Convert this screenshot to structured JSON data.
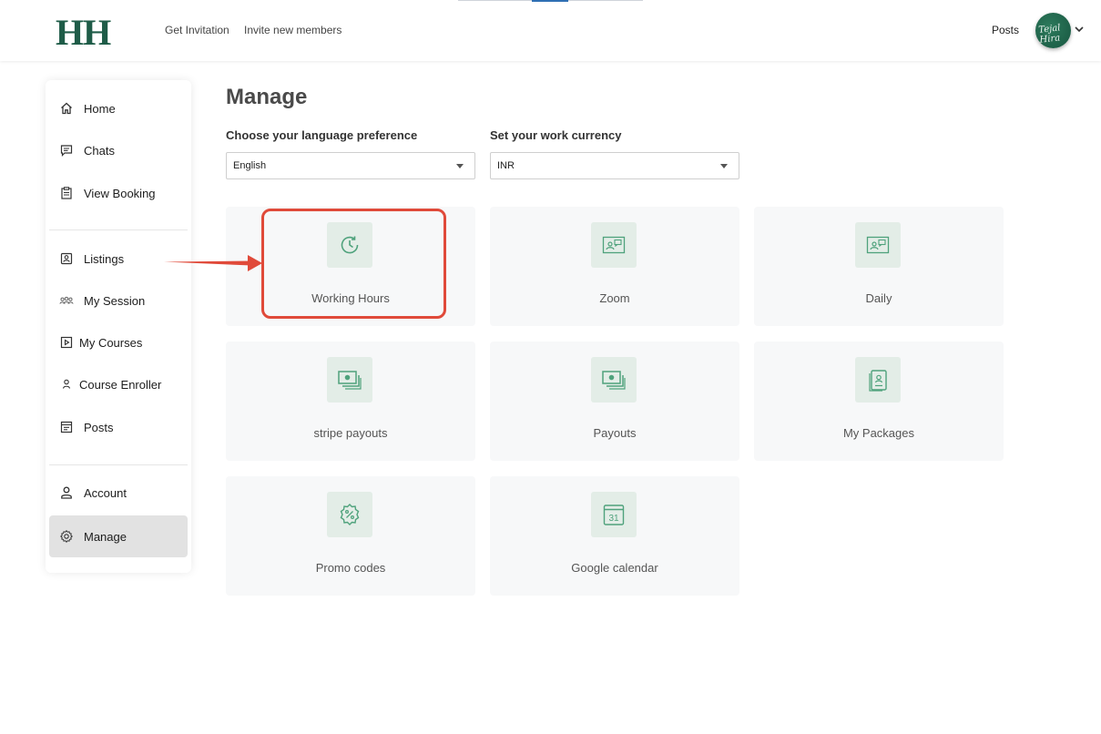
{
  "header": {
    "logo": "HH",
    "links": [
      "Get Invitation",
      "Invite new members"
    ],
    "posts_link": "Posts",
    "avatar_text": "Tejal Hira"
  },
  "sidebar": {
    "group1": [
      {
        "label": "Home",
        "icon": "home-icon"
      },
      {
        "label": "Chats",
        "icon": "chat-icon"
      },
      {
        "label": "View Booking",
        "icon": "clipboard-icon"
      }
    ],
    "group2": [
      {
        "label": "Listings",
        "icon": "listing-icon"
      },
      {
        "label": "My Session",
        "icon": "group-icon"
      },
      {
        "label": "My Courses",
        "icon": "play-icon"
      },
      {
        "label": "Course Enroller",
        "icon": "user-icon"
      },
      {
        "label": "Posts",
        "icon": "posts-icon"
      }
    ],
    "group3": [
      {
        "label": "Account",
        "icon": "user-icon"
      },
      {
        "label": "Manage",
        "icon": "gear-icon",
        "active": true
      }
    ]
  },
  "main": {
    "title": "Manage",
    "language": {
      "label": "Choose your language preference",
      "value": "English"
    },
    "currency": {
      "label": "Set your work currency",
      "value": "INR"
    },
    "cards": [
      {
        "label": "Working Hours",
        "icon": "clock-icon"
      },
      {
        "label": "Zoom",
        "icon": "video-card-icon"
      },
      {
        "label": "Daily",
        "icon": "video-card-icon"
      },
      {
        "label": "stripe payouts",
        "icon": "cash-icon"
      },
      {
        "label": "Payouts",
        "icon": "cash-icon"
      },
      {
        "label": "My Packages",
        "icon": "package-icon"
      },
      {
        "label": "Promo codes",
        "icon": "discount-badge-icon"
      },
      {
        "label": "Google calendar",
        "icon": "calendar-icon"
      }
    ],
    "calendar_day": "31"
  },
  "colors": {
    "brand": "#1f5c48",
    "icon_green": "#4fa27c",
    "icon_bg": "#e3ede7",
    "card_bg": "#f7f8f9",
    "highlight": "#e04a3a",
    "active_nav": "#e2e2e2"
  }
}
